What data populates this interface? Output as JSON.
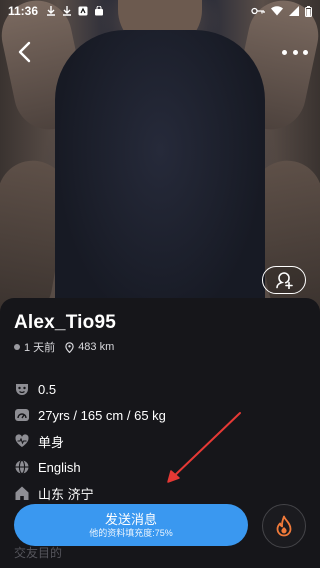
{
  "status_bar": {
    "time": "11:36"
  },
  "profile": {
    "name": "Alex_Tio95",
    "last_active": "1 天前",
    "distance": "483 km"
  },
  "details": [
    {
      "icon": "mask-icon",
      "text": "0.5"
    },
    {
      "icon": "body-stats-icon",
      "text": "27yrs / 165 cm / 65 kg"
    },
    {
      "icon": "heart-icon",
      "text": "单身"
    },
    {
      "icon": "globe-icon",
      "text": "English"
    },
    {
      "icon": "home-icon",
      "text": "山东 济宁"
    }
  ],
  "section_peek": "交友目的",
  "actions": {
    "send_label": "发送消息",
    "send_sub": "他的资料填充度:75%"
  },
  "colors": {
    "accent": "#3a98f0",
    "fire": "#f07a3a",
    "annotation": "#e53935"
  }
}
